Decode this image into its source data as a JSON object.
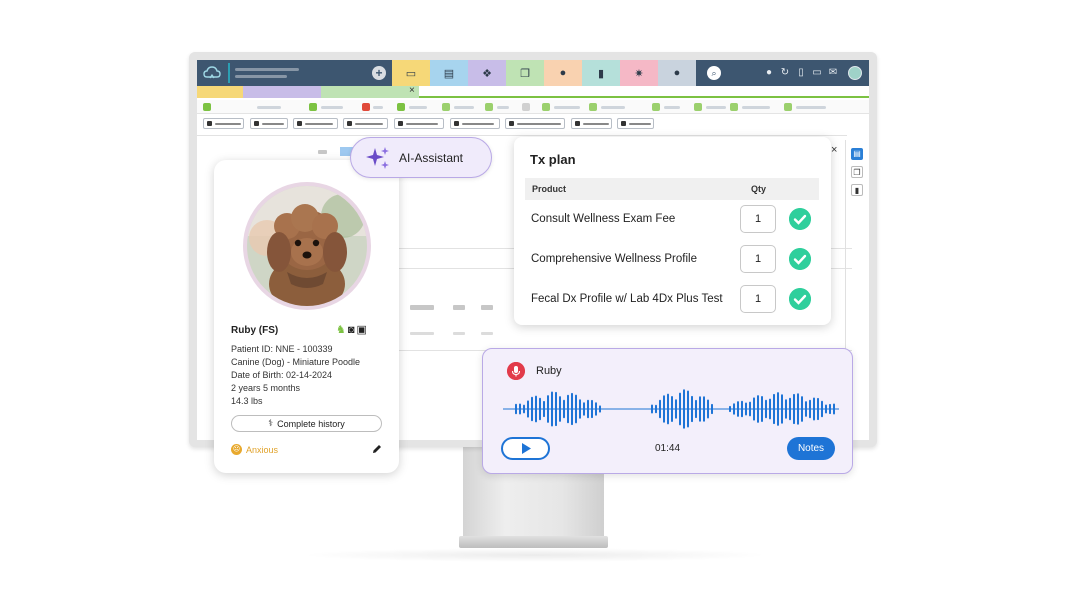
{
  "app": {
    "close_glyph_1": "×",
    "close_glyph_2": "×",
    "panel_close": "×",
    "new_glyph": "+"
  },
  "ai_assistant": {
    "label": "AI-Assistant"
  },
  "patient": {
    "name": "Ruby (FS)",
    "patient_id": "Patient ID: NNE - 100339",
    "species_breed": "Canine (Dog) - Miniature Poodle",
    "dob": "Date of Birth: 02-14-2024",
    "age": "2 years 5 months",
    "weight": "14.3 lbs",
    "history_button": "Complete history",
    "mood": "Anxious"
  },
  "tx_plan": {
    "title": "Tx plan",
    "col_product": "Product",
    "col_qty": "Qty",
    "items": [
      {
        "product": "Consult Wellness Exam Fee",
        "qty": "1"
      },
      {
        "product": "Comprehensive Wellness Profile",
        "qty": "1"
      },
      {
        "product": "Fecal Dx Profile w/ Lab 4Dx Plus Test",
        "qty": "1"
      }
    ]
  },
  "recording": {
    "name": "Ruby",
    "time": "01:44",
    "notes_button": "Notes"
  },
  "colors": {
    "header": "#3d5670",
    "accent_green": "#7cc242",
    "check_green": "#2fcf9c",
    "primary_blue": "#1e74d6",
    "ai_purple": "#b9a9e6",
    "record_red": "#e23b4a"
  },
  "icons": {
    "top_tabs": [
      "browser-icon",
      "contacts-icon",
      "paw-icon",
      "documents-icon",
      "money-bag-icon",
      "chart-icon",
      "gear-icon",
      "help-icon"
    ],
    "toolbar": [
      "search-icon",
      "drop-icon",
      "history-icon",
      "document-icon",
      "print-icon",
      "mail-icon",
      "avatar"
    ]
  }
}
